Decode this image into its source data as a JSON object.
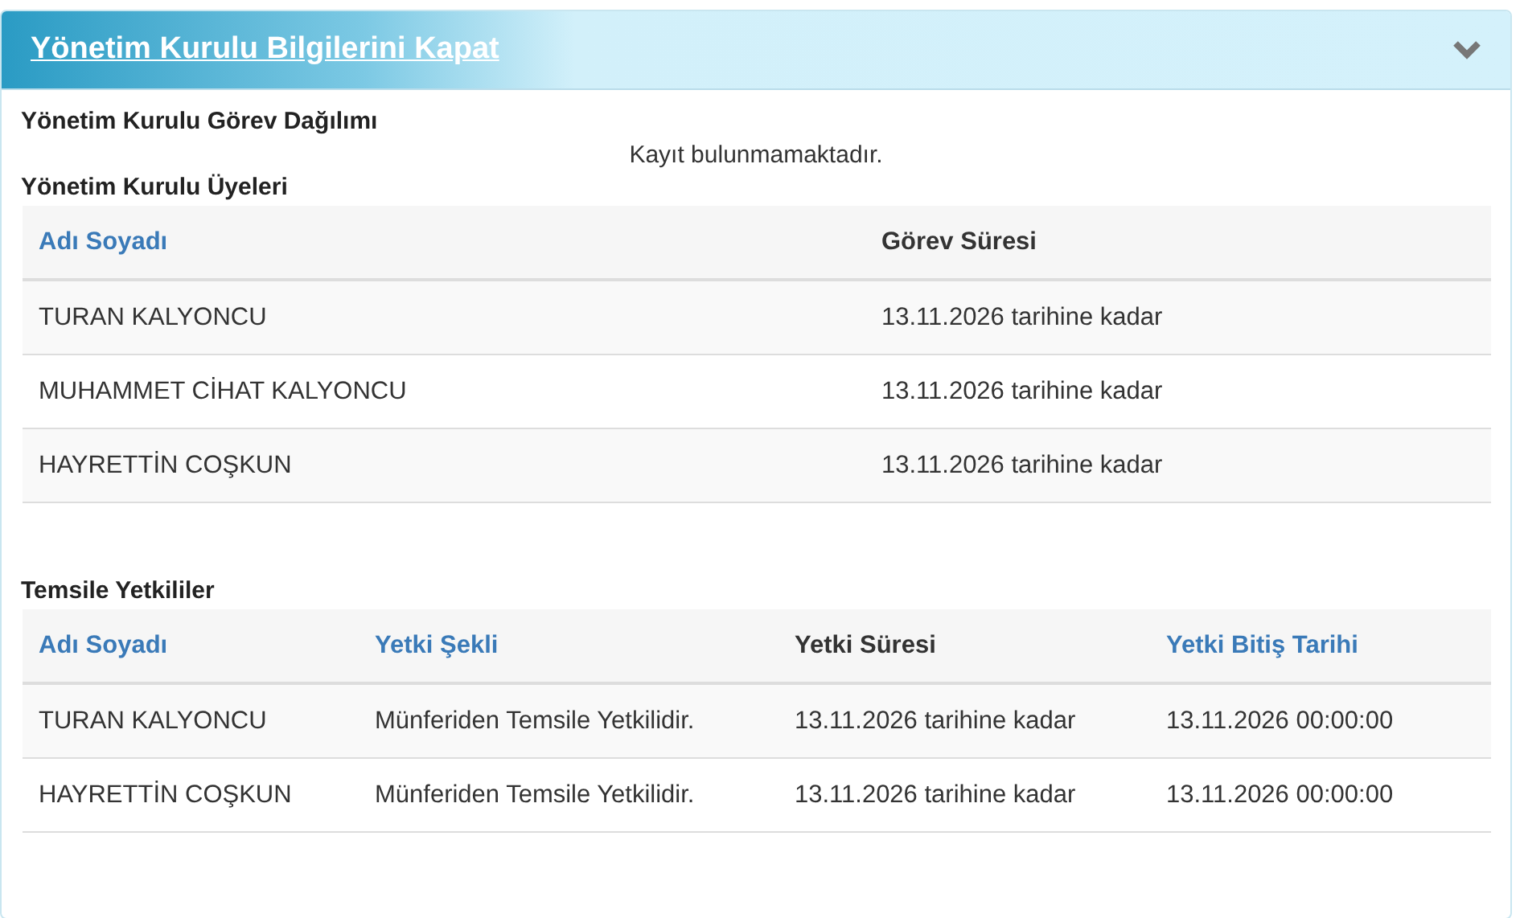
{
  "panel": {
    "title": "Yönetim Kurulu Bilgilerini Kapat",
    "expanded": true
  },
  "sections": [
    {
      "heading": "Yönetim Kurulu Görev Dağılımı",
      "empty_message": "Kayıt bulunmamaktadır."
    },
    {
      "heading": "Yönetim Kurulu Üyeleri",
      "table": {
        "columns": [
          {
            "label": "Adı Soyadı",
            "link": true
          },
          {
            "label": "Görev Süresi",
            "link": false
          }
        ],
        "rows": [
          [
            "TURAN KALYONCU",
            "13.11.2026 tarihine kadar"
          ],
          [
            "MUHAMMET CİHAT KALYONCU",
            "13.11.2026 tarihine kadar"
          ],
          [
            "HAYRETTİN COŞKUN",
            "13.11.2026 tarihine kadar"
          ]
        ]
      }
    },
    {
      "heading": "Temsile Yetkililer",
      "table": {
        "columns": [
          {
            "label": "Adı Soyadı",
            "link": true
          },
          {
            "label": "Yetki Şekli",
            "link": true
          },
          {
            "label": "Yetki Süresi",
            "link": false
          },
          {
            "label": "Yetki Bitiş Tarihi",
            "link": true
          }
        ],
        "rows": [
          [
            "TURAN KALYONCU",
            "Münferiden Temsile Yetkilidir.",
            "13.11.2026 tarihine kadar",
            "13.11.2026 00:00:00"
          ],
          [
            "HAYRETTİN COŞKUN",
            "Münferiden Temsile Yetkilidir.",
            "13.11.2026 tarihine kadar",
            "13.11.2026 00:00:00"
          ]
        ]
      }
    }
  ]
}
